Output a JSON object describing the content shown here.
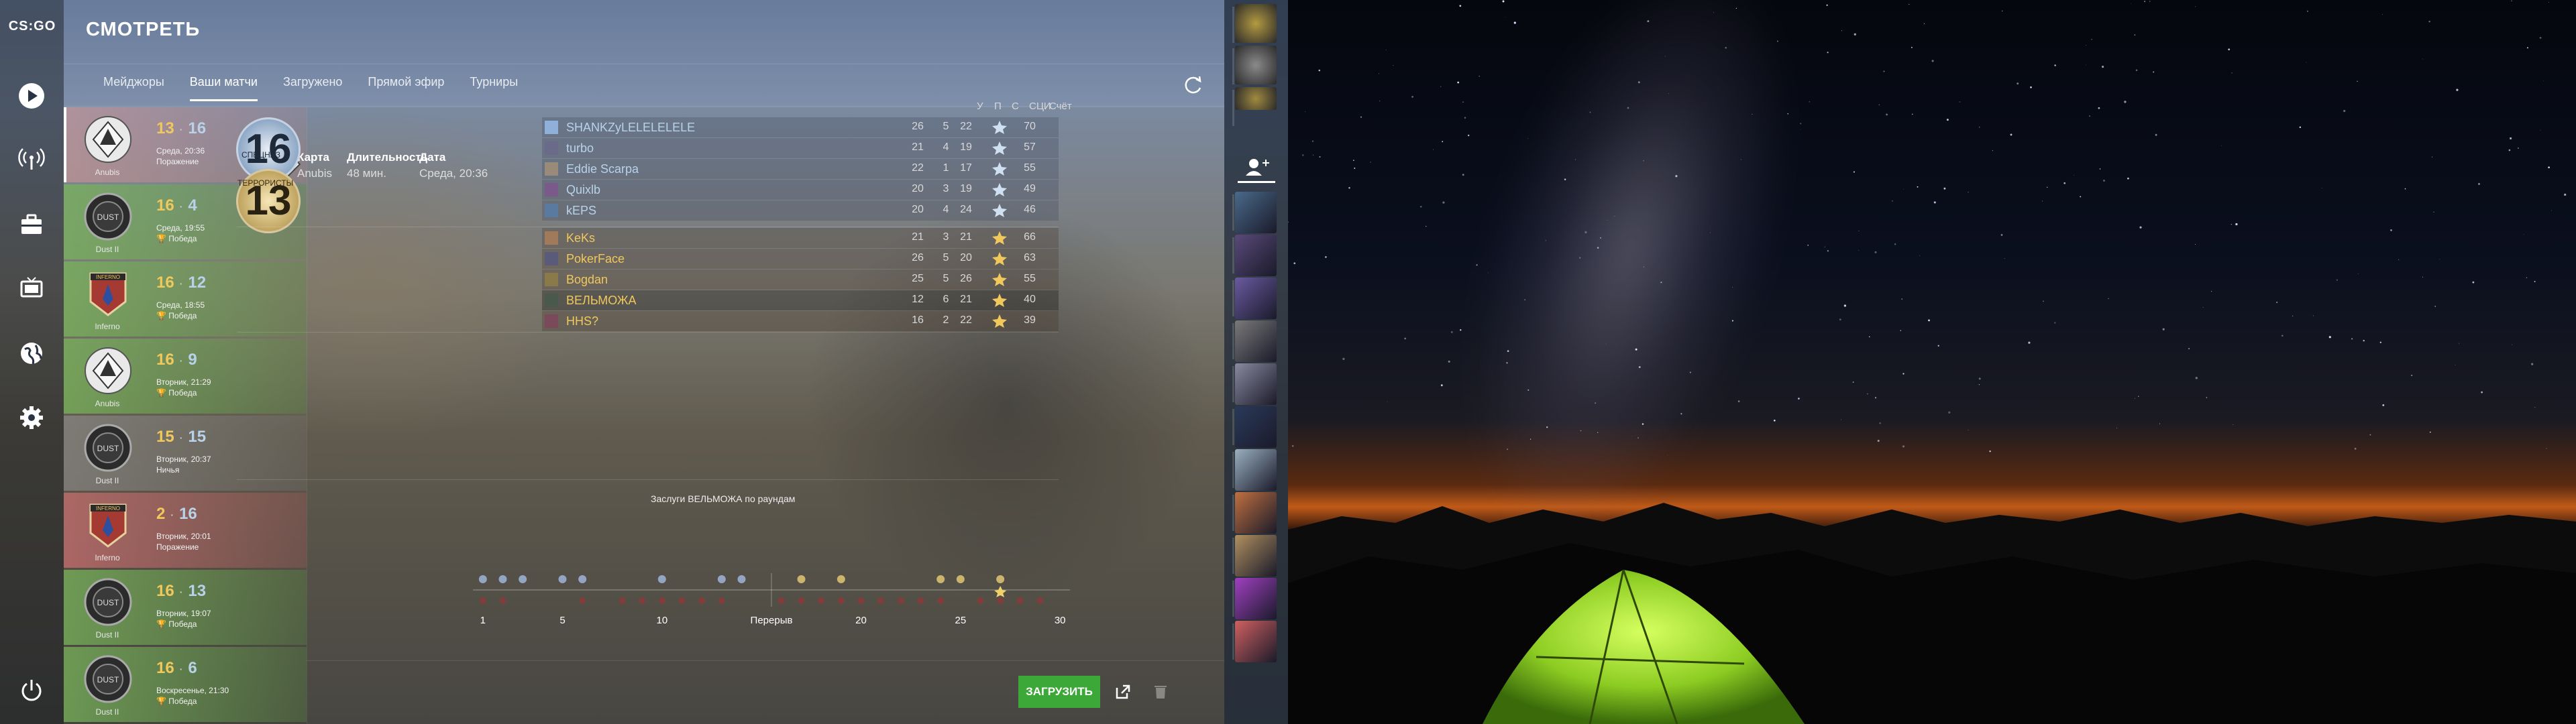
{
  "app": {
    "logo": "CS:GO",
    "title": "СМОТРЕТЬ",
    "tabs": [
      {
        "label": "Мейджоры"
      },
      {
        "label": "Ваши матчи"
      },
      {
        "label": "Загружено"
      },
      {
        "label": "Прямой эфир"
      },
      {
        "label": "Турниры"
      }
    ],
    "nav_icons": [
      "play-icon",
      "broadcast-icon",
      "inventory-icon",
      "tv-icon",
      "globe-icon",
      "settings-icon",
      "power-icon"
    ]
  },
  "matches": [
    {
      "map": "Anubis",
      "a": "13",
      "b": "16",
      "date": "Среда, 20:36",
      "result": "Поражение",
      "kind": "sel"
    },
    {
      "map": "Dust II",
      "a": "16",
      "b": "4",
      "date": "Среда, 19:55",
      "result": "Победа",
      "kind": "win"
    },
    {
      "map": "Inferno",
      "a": "16",
      "b": "12",
      "date": "Среда, 18:55",
      "result": "Победа",
      "kind": "win"
    },
    {
      "map": "Anubis",
      "a": "16",
      "b": "9",
      "date": "Вторник, 21:29",
      "result": "Победа",
      "kind": "win"
    },
    {
      "map": "Dust II",
      "a": "15",
      "b": "15",
      "date": "Вторник, 20:37",
      "result": "Ничья",
      "kind": "draw"
    },
    {
      "map": "Inferno",
      "a": "2",
      "b": "16",
      "date": "Вторник, 20:01",
      "result": "Поражение",
      "kind": "loss"
    },
    {
      "map": "Dust II",
      "a": "16",
      "b": "13",
      "date": "Вторник, 19:07",
      "result": "Победа",
      "kind": "win"
    },
    {
      "map": "Dust II",
      "a": "16",
      "b": "6",
      "date": "Воскресенье, 21:30",
      "result": "Победа",
      "kind": "win"
    }
  ],
  "detail": {
    "map_label": "Карта",
    "map_value": "Anubis",
    "duration_label": "Длительность",
    "duration_value": "48 мин.",
    "date_label": "Дата",
    "date_value": "Среда, 20:36",
    "ct_score": "16",
    "ct_label": "СПЕЦНАЗ",
    "t_score": "13",
    "t_label": "ТЕРРОРИСТЫ",
    "columns": [
      "У",
      "П",
      "С",
      "СЦИ",
      "Счёт"
    ],
    "ct_players": [
      {
        "name": "SHANKZyLELELELELE",
        "k": "26",
        "a": "5",
        "d": "22",
        "score": "70"
      },
      {
        "name": "turbo",
        "k": "21",
        "a": "4",
        "d": "19",
        "score": "57"
      },
      {
        "name": "Eddie Scarpa",
        "k": "22",
        "a": "1",
        "d": "17",
        "score": "55"
      },
      {
        "name": "Quixlb",
        "k": "20",
        "a": "3",
        "d": "19",
        "score": "49"
      },
      {
        "name": "kEPS",
        "k": "20",
        "a": "4",
        "d": "24",
        "score": "46"
      }
    ],
    "t_players": [
      {
        "name": "KeKs",
        "k": "21",
        "a": "3",
        "d": "21",
        "score": "66"
      },
      {
        "name": "PokerFace",
        "k": "26",
        "a": "5",
        "d": "20",
        "score": "63"
      },
      {
        "name": "Bogdan",
        "k": "25",
        "a": "5",
        "d": "26",
        "score": "55"
      },
      {
        "name": "ВЕЛЬМОЖА",
        "k": "12",
        "a": "6",
        "d": "21",
        "score": "40"
      },
      {
        "name": "HHS?",
        "k": "16",
        "a": "2",
        "d": "22",
        "score": "39"
      }
    ],
    "round_caption": "Заслуги ВЕЛЬМОЖА по раундам",
    "round_ticks": [
      "1",
      "5",
      "10",
      "Перерыв",
      "20",
      "25",
      "30"
    ],
    "load_button": "ЗАГРУЗИТЬ"
  },
  "colors": {
    "ct": "#b8d2ea",
    "t": "#f0c85c",
    "win": "#6fa85a",
    "loss": "#c46a6a",
    "load": "#3ca838"
  }
}
